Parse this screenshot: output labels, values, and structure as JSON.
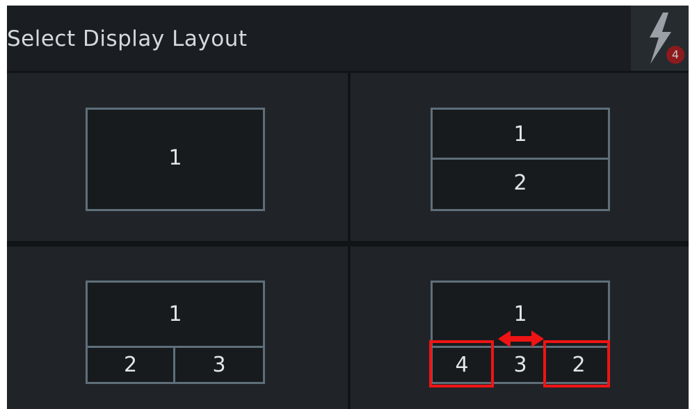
{
  "header": {
    "title": "Select Display Layout",
    "power_badge": "4"
  },
  "layouts": [
    {
      "id": "single",
      "panes": [
        "1"
      ]
    },
    {
      "id": "split-horizontal",
      "panes": [
        "1",
        "2"
      ]
    },
    {
      "id": "top-plus-two",
      "panes": [
        "1",
        "2",
        "3"
      ]
    },
    {
      "id": "top-plus-three",
      "panes": [
        "1",
        "4",
        "3",
        "2"
      ]
    }
  ],
  "colors": {
    "background": "#111417",
    "cell": "#202429",
    "frame": "#5e6f7a",
    "highlight": "#ef1414",
    "badge": "#8d1a1d"
  },
  "icons": {
    "power": "lightning-bolt-icon",
    "swap": "double-arrow-icon"
  }
}
